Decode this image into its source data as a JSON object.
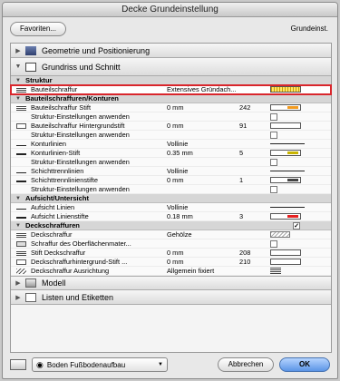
{
  "window": {
    "title": "Decke Grundeinstellung",
    "favorites": "Favoriten...",
    "context": "Grundeinst."
  },
  "sections": {
    "geometry": "Geometrie und Positionierung",
    "floorplan": "Grundriss und Schnitt",
    "model": "Modell",
    "lists": "Listen und Etiketten"
  },
  "groups": {
    "struktur": "Struktur",
    "bauteil": "Bauteilschraffuren/Konturen",
    "aufsicht": "Aufsicht/Untersicht",
    "deck": "Deckschraffuren"
  },
  "rows": {
    "r1": {
      "label": "Bauteilschraffur",
      "value": "Extensives Gründach..."
    },
    "r2": {
      "label": "Bauteilschraffur Stift",
      "value": "0 mm",
      "num": "242",
      "color": "#f29a1f"
    },
    "r3": {
      "label": "Struktur-Einstellungen anwenden"
    },
    "r4": {
      "label": "Bauteilschraffur Hintergrundstift",
      "value": "0 mm",
      "num": "91"
    },
    "r5": {
      "label": "Struktur-Einstellungen anwenden"
    },
    "r6": {
      "label": "Konturlinien",
      "value": "Vollinie"
    },
    "r7": {
      "label": "Konturlinien-Stift",
      "value": "0.35 mm",
      "num": "5",
      "color": "#c8b400"
    },
    "r8": {
      "label": "Struktur-Einstellungen anwenden"
    },
    "r9": {
      "label": "Schichttrennlinien",
      "value": "Vollinie"
    },
    "r10": {
      "label": "Schichttrennlinienstifte",
      "value": "0 mm",
      "num": "1",
      "color": "#444444"
    },
    "r11": {
      "label": "Struktur-Einstellungen anwenden"
    },
    "r12": {
      "label": "Aufsicht Linien",
      "value": "Vollinie"
    },
    "r13": {
      "label": "Aufsicht Linienstifte",
      "value": "0.18 mm",
      "num": "3",
      "color": "#e52020"
    },
    "r14": {
      "label": "Deckschraffur",
      "value": "Gehölze"
    },
    "r15": {
      "label": "Schraffur des Oberflächenmater..."
    },
    "r16": {
      "label": "Stift Deckschraffur",
      "value": "0 mm",
      "num": "208"
    },
    "r17": {
      "label": "Deckschraffurhintergrund-Stift ...",
      "value": "0 mm",
      "num": "210"
    },
    "r18": {
      "label": "Deckschraffur Ausrichtung",
      "value": "Allgemein fixiert"
    }
  },
  "footer": {
    "layer": "Boden Fußbodenaufbau",
    "cancel": "Abbrechen",
    "ok": "OK"
  }
}
